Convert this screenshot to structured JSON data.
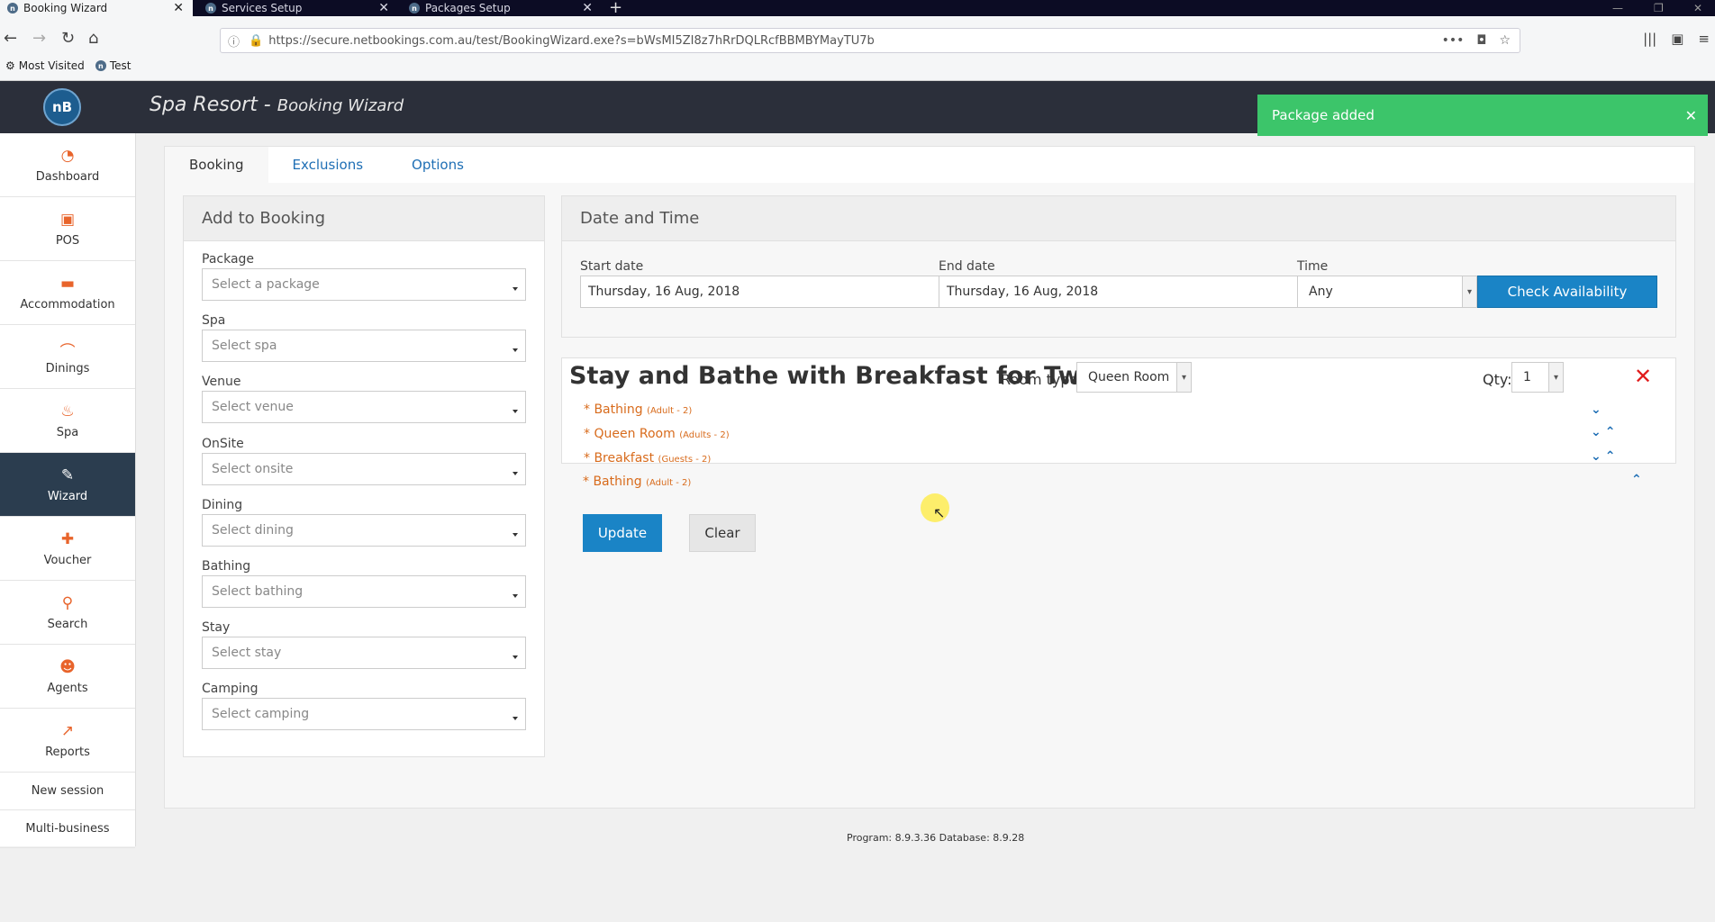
{
  "browser": {
    "tabs": [
      {
        "label": "Booking Wizard",
        "active": true
      },
      {
        "label": "Services Setup",
        "active": false
      },
      {
        "label": "Packages Setup",
        "active": false
      }
    ],
    "url": "https://secure.netbookings.com.au/test/BookingWizard.exe?s=bWsMI5ZI8z7hRrDQLRcfBBMBYMayTU7b",
    "bookmarks": [
      "Most Visited",
      "Test"
    ]
  },
  "app": {
    "logo": "nB",
    "title": "Spa Resort - ",
    "subtitle": "Booking Wizard",
    "toast": "Package added"
  },
  "sidebar": {
    "items": [
      {
        "label": "Dashboard",
        "icon": "dashboard-icon"
      },
      {
        "label": "POS",
        "icon": "pos-icon"
      },
      {
        "label": "Accommodation",
        "icon": "bed-icon"
      },
      {
        "label": "Dinings",
        "icon": "dining-icon"
      },
      {
        "label": "Spa",
        "icon": "spa-icon"
      },
      {
        "label": "Wizard",
        "icon": "wand-icon",
        "active": true
      },
      {
        "label": "Voucher",
        "icon": "gift-icon"
      },
      {
        "label": "Search",
        "icon": "search-icon"
      },
      {
        "label": "Agents",
        "icon": "agent-icon"
      },
      {
        "label": "Reports",
        "icon": "chart-icon"
      }
    ],
    "links": [
      "New session",
      "Multi-business"
    ]
  },
  "main": {
    "tabs": [
      "Booking",
      "Exclusions",
      "Options"
    ],
    "add_to_booking": {
      "heading": "Add to Booking",
      "fields": [
        {
          "label": "Package",
          "placeholder": "Select a package"
        },
        {
          "label": "Spa",
          "placeholder": "Select spa"
        },
        {
          "label": "Venue",
          "placeholder": "Select venue"
        },
        {
          "label": "OnSite",
          "placeholder": "Select onsite"
        },
        {
          "label": "Dining",
          "placeholder": "Select dining"
        },
        {
          "label": "Bathing",
          "placeholder": "Select bathing"
        },
        {
          "label": "Stay",
          "placeholder": "Select stay"
        },
        {
          "label": "Camping",
          "placeholder": "Select camping"
        }
      ]
    },
    "date_time": {
      "heading": "Date and Time",
      "start_label": "Start date",
      "start_value": "Thursday, 16 Aug, 2018",
      "end_label": "End date",
      "end_value": "Thursday, 16 Aug, 2018",
      "time_label": "Time",
      "time_value": "Any",
      "check_button": "Check Availability"
    },
    "package": {
      "title": "Stay and Bathe with Breakfast for Two",
      "room_type_label": "Room type:",
      "room_type_value": "Queen Room",
      "qty_label": "Qty:",
      "qty_value": "1",
      "lines": [
        {
          "name": "* Bathing",
          "detail": "(Adult - 2)"
        },
        {
          "name": "* Queen Room",
          "detail": "(Adults - 2)"
        },
        {
          "name": "* Breakfast",
          "detail": "(Guests - 2)"
        },
        {
          "name": "* Bathing",
          "detail": "(Adult - 2)"
        }
      ]
    },
    "update_button": "Update",
    "clear_button": "Clear"
  },
  "footer": "Program: 8.9.3.36 Database: 8.9.28",
  "colors": {
    "accent": "#1a84c6",
    "toast": "#3cc56a",
    "header": "#2b2f3a",
    "sidebar_active": "#2b3d4f",
    "line_item": "#d86b1c"
  }
}
